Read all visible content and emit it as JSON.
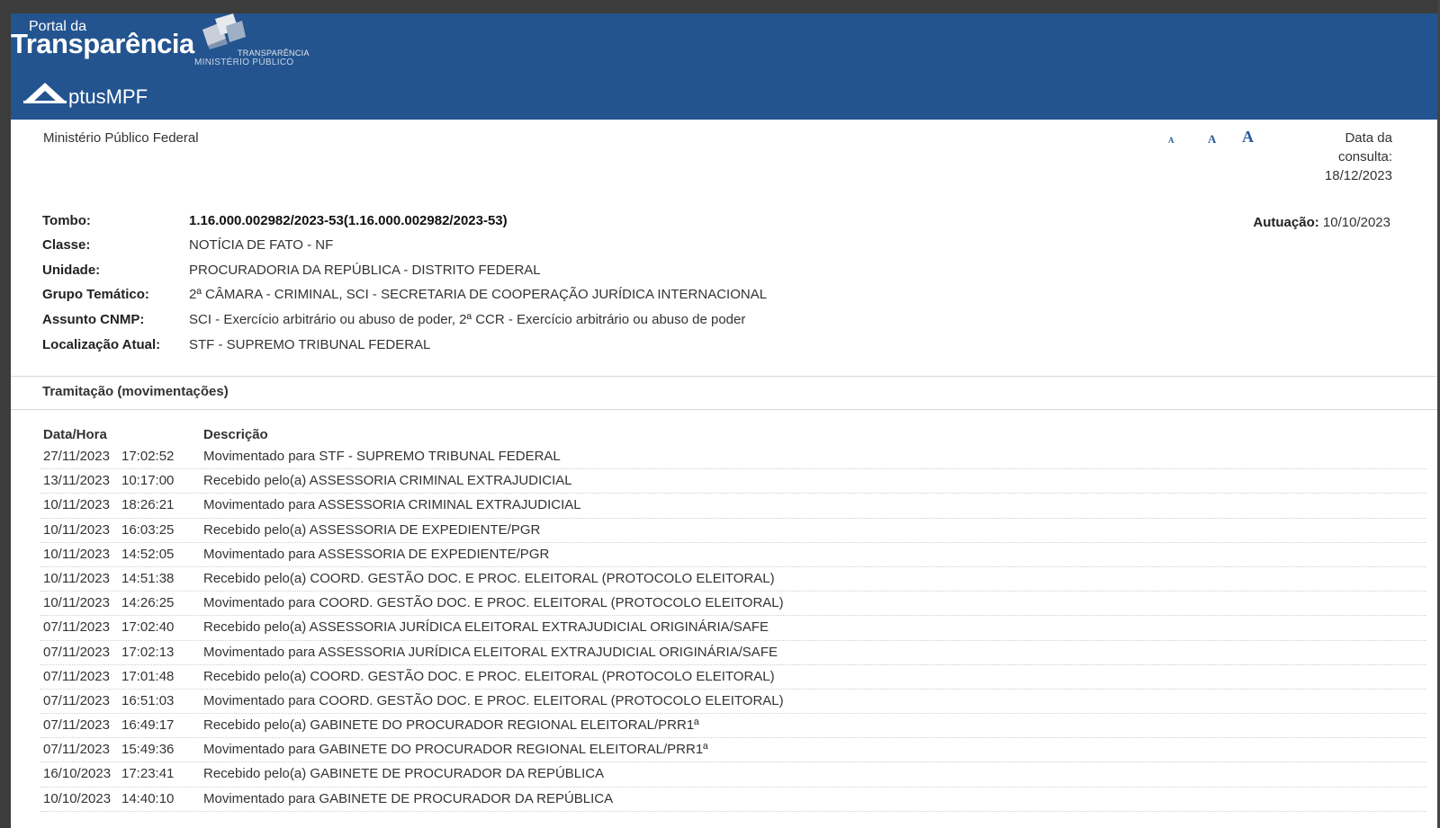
{
  "header": {
    "logo_small": "Portal da",
    "logo_big": "Transparência",
    "logo_sub1": "TRANSPARÊNCIA",
    "logo_sub2": "MINISTÉRIO PÚBLICO",
    "aptus": "ptusMPF",
    "bg_color": "#23548f"
  },
  "info": {
    "org": "Ministério Público Federal",
    "font_sizes": [
      "A",
      "A",
      "A"
    ],
    "consulta_label1": "Data da",
    "consulta_label2": "consulta:",
    "consulta_date": "18/12/2023",
    "autuacao_label": "Autuação:",
    "autuacao_value": "10/10/2023"
  },
  "details": [
    {
      "label": "Tombo:",
      "value": "1.16.000.002982/2023-53(1.16.000.002982/2023-53)"
    },
    {
      "label": "Classe:",
      "value": "NOTÍCIA DE FATO - NF"
    },
    {
      "label": "Unidade:",
      "value": "PROCURADORIA DA REPÚBLICA - DISTRITO FEDERAL"
    },
    {
      "label": "Grupo Temático:",
      "value": "2ª CÂMARA - CRIMINAL, SCI - SECRETARIA DE COOPERAÇÃO JURÍDICA INTERNACIONAL"
    },
    {
      "label": "Assunto CNMP:",
      "value": "SCI - Exercício arbitrário ou abuso de poder, 2ª CCR - Exercício arbitrário ou abuso de poder"
    },
    {
      "label": "Localização Atual:",
      "value": "STF - SUPREMO TRIBUNAL FEDERAL"
    }
  ],
  "tramitacao": {
    "title": "Tramitação (movimentações)",
    "col_date": "Data/Hora",
    "col_desc": "Descrição",
    "rows": [
      {
        "date": "27/11/2023",
        "time": "17:02:52",
        "desc": "Movimentado para STF - SUPREMO TRIBUNAL FEDERAL"
      },
      {
        "date": "13/11/2023",
        "time": "10:17:00",
        "desc": "Recebido pelo(a) ASSESSORIA CRIMINAL EXTRAJUDICIAL"
      },
      {
        "date": "10/11/2023",
        "time": "18:26:21",
        "desc": "Movimentado para ASSESSORIA CRIMINAL EXTRAJUDICIAL"
      },
      {
        "date": "10/11/2023",
        "time": "16:03:25",
        "desc": "Recebido pelo(a) ASSESSORIA DE EXPEDIENTE/PGR"
      },
      {
        "date": "10/11/2023",
        "time": "14:52:05",
        "desc": "Movimentado para ASSESSORIA DE EXPEDIENTE/PGR"
      },
      {
        "date": "10/11/2023",
        "time": "14:51:38",
        "desc": "Recebido pelo(a) COORD. GESTÃO DOC. E PROC. ELEITORAL (PROTOCOLO ELEITORAL)"
      },
      {
        "date": "10/11/2023",
        "time": "14:26:25",
        "desc": "Movimentado para COORD. GESTÃO DOC. E PROC. ELEITORAL (PROTOCOLO ELEITORAL)"
      },
      {
        "date": "07/11/2023",
        "time": "17:02:40",
        "desc": "Recebido pelo(a) ASSESSORIA JURÍDICA ELEITORAL EXTRAJUDICIAL ORIGINÁRIA/SAFE"
      },
      {
        "date": "07/11/2023",
        "time": "17:02:13",
        "desc": "Movimentado para ASSESSORIA JURÍDICA ELEITORAL EXTRAJUDICIAL ORIGINÁRIA/SAFE"
      },
      {
        "date": "07/11/2023",
        "time": "17:01:48",
        "desc": "Recebido pelo(a) COORD. GESTÃO DOC. E PROC. ELEITORAL (PROTOCOLO ELEITORAL)"
      },
      {
        "date": "07/11/2023",
        "time": "16:51:03",
        "desc": "Movimentado para COORD. GESTÃO DOC. E PROC. ELEITORAL (PROTOCOLO ELEITORAL)"
      },
      {
        "date": "07/11/2023",
        "time": "16:49:17",
        "desc": "Recebido pelo(a) GABINETE DO PROCURADOR REGIONAL ELEITORAL/PRR1ª"
      },
      {
        "date": "07/11/2023",
        "time": "15:49:36",
        "desc": "Movimentado para GABINETE DO PROCURADOR REGIONAL ELEITORAL/PRR1ª"
      },
      {
        "date": "16/10/2023",
        "time": "17:23:41",
        "desc": "Recebido pelo(a) GABINETE DE PROCURADOR DA REPÚBLICA"
      },
      {
        "date": "10/10/2023",
        "time": "14:40:10",
        "desc": "Movimentado para GABINETE DE PROCURADOR DA REPÚBLICA"
      }
    ]
  }
}
